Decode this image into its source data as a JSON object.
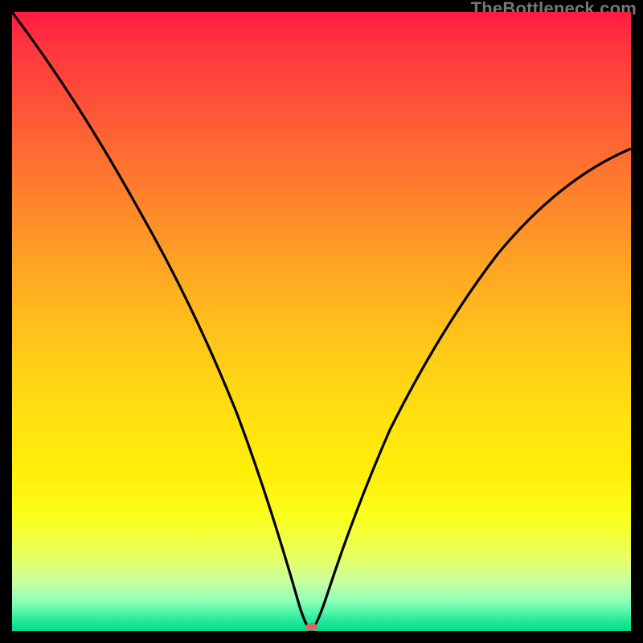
{
  "attribution": "TheBottleneck.com",
  "chart_data": {
    "type": "line",
    "title": "",
    "xlabel": "",
    "ylabel": "",
    "x_range": [
      0,
      100
    ],
    "y_range": [
      0,
      100
    ],
    "minimum_marker": {
      "x": 48,
      "y": 0
    },
    "series": [
      {
        "name": "bottleneck-curve",
        "x": [
          0,
          5,
          10,
          15,
          20,
          25,
          30,
          35,
          40,
          43,
          45,
          47,
          48,
          49,
          51,
          55,
          60,
          65,
          70,
          75,
          80,
          85,
          90,
          95,
          100
        ],
        "y": [
          100,
          91,
          82,
          72,
          62,
          52,
          42,
          31,
          19,
          11,
          6,
          2,
          0,
          2,
          7,
          17,
          27,
          36,
          44,
          51,
          57,
          62,
          66,
          70,
          73
        ]
      }
    ]
  },
  "colors": {
    "background": "#000000",
    "curve": "#000000",
    "marker": "#c77168",
    "gradient_top": "#ff1a44",
    "gradient_bottom": "#00dd88"
  }
}
